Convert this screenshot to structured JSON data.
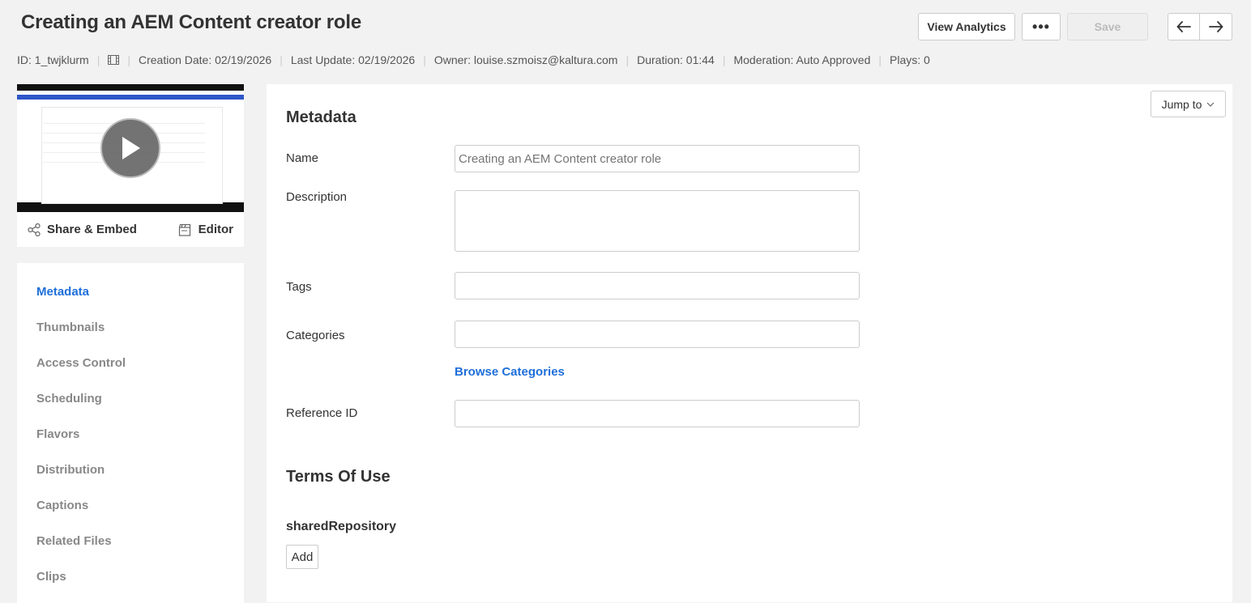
{
  "header": {
    "title": "Creating an AEM Content creator role",
    "view_analytics_label": "View Analytics",
    "more_label": "•••",
    "save_label": "Save"
  },
  "meta": {
    "id": "ID: 1_twjklurm",
    "creation_date": "Creation Date: 02/19/2026",
    "last_update": "Last Update: 02/19/2026",
    "owner": "Owner: louise.szmoisz@kaltura.com",
    "duration": "Duration: 01:44",
    "moderation": "Moderation: Auto Approved",
    "plays": "Plays: 0",
    "separator": "|"
  },
  "player": {
    "share_embed_label": "Share & Embed",
    "editor_label": "Editor"
  },
  "sidebar": {
    "items": [
      {
        "label": "Metadata",
        "active": true
      },
      {
        "label": "Thumbnails",
        "active": false
      },
      {
        "label": "Access Control",
        "active": false
      },
      {
        "label": "Scheduling",
        "active": false
      },
      {
        "label": "Flavors",
        "active": false
      },
      {
        "label": "Distribution",
        "active": false
      },
      {
        "label": "Captions",
        "active": false
      },
      {
        "label": "Related Files",
        "active": false
      },
      {
        "label": "Clips",
        "active": false
      }
    ]
  },
  "main": {
    "jump_to_label": "Jump to",
    "metadata_title": "Metadata",
    "fields": {
      "name_label": "Name",
      "name_placeholder": "Creating an AEM Content creator role",
      "description_label": "Description",
      "description_value": "",
      "tags_label": "Tags",
      "tags_value": "",
      "categories_label": "Categories",
      "categories_value": "",
      "browse_categories_label": "Browse Categories",
      "reference_id_label": "Reference ID",
      "reference_id_value": ""
    },
    "terms_title": "Terms Of Use",
    "shared_repository_label": "sharedRepository",
    "add_label": "Add"
  },
  "colors": {
    "accent": "#1e6fd9",
    "background": "#f2f2f2",
    "panel": "#ffffff"
  },
  "icons": [
    "more-icon",
    "arrow-left-icon",
    "arrow-right-icon",
    "film-icon",
    "play-icon",
    "share-icon",
    "editor-icon",
    "chevron-down-icon"
  ]
}
